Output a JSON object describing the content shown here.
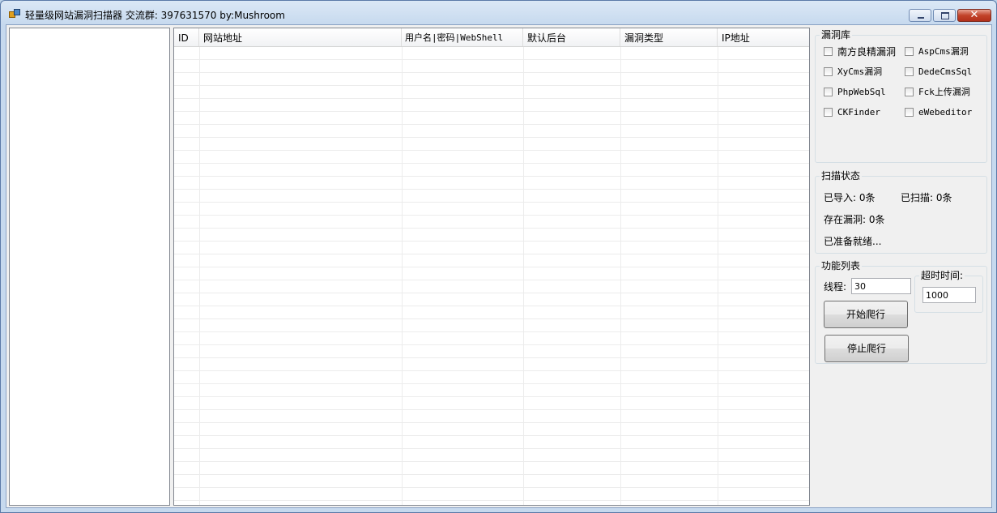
{
  "window": {
    "title": "轻量级网站漏洞扫描器   交流群: 397631570   by:Mushroom",
    "close_symbol": "✕"
  },
  "grid": {
    "columns": [
      "ID",
      "网站地址",
      "用户名|密码|WebShell",
      "默认后台",
      "漏洞类型",
      "IP地址"
    ]
  },
  "vuln_library": {
    "title": "漏洞库",
    "checkboxes": [
      {
        "label": "南方良精漏洞",
        "checked": false
      },
      {
        "label": "AspCms漏洞",
        "checked": false
      },
      {
        "label": "XyCms漏洞",
        "checked": false
      },
      {
        "label": "DedeCmsSql",
        "checked": false
      },
      {
        "label": "PhpWebSql",
        "checked": false
      },
      {
        "label": "Fck上传漏洞",
        "checked": false
      },
      {
        "label": "CKFinder",
        "checked": false
      },
      {
        "label": "eWebeditor",
        "checked": false
      }
    ]
  },
  "scan_status": {
    "title": "扫描状态",
    "imported": "已导入: 0条",
    "scanned": "已扫描: 0条",
    "vulnerable": "存在漏洞: 0条",
    "status": "已准备就绪..."
  },
  "functions": {
    "title": "功能列表",
    "threads_label": "线程:",
    "threads_value": "30",
    "start_button": "开始爬行",
    "stop_button": "停止爬行"
  },
  "timeout": {
    "title": "超时时间:",
    "value": "1000"
  }
}
